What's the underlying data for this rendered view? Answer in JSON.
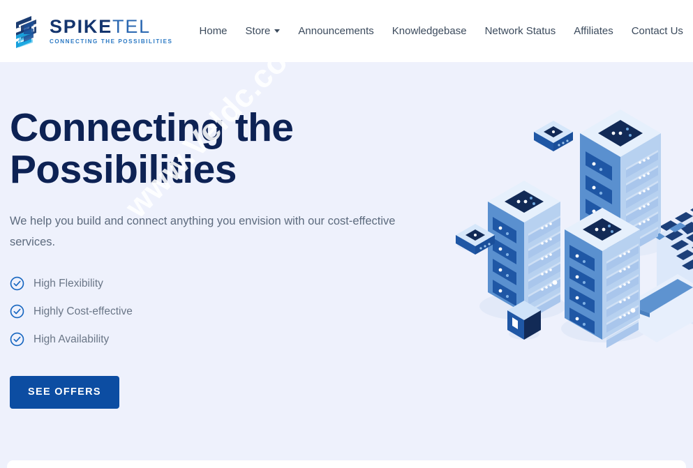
{
  "brand": {
    "name_bold": "SPIKE",
    "name_light": "TEL",
    "tagline": "CONNECTING THE POSSIBILITIES",
    "logo_icon": "spiketel-cube-s-logo"
  },
  "nav": {
    "items": [
      {
        "label": "Home",
        "has_caret": false
      },
      {
        "label": "Store",
        "has_caret": true
      },
      {
        "label": "Announcements",
        "has_caret": false
      },
      {
        "label": "Knowledgebase",
        "has_caret": false
      },
      {
        "label": "Network Status",
        "has_caret": false
      },
      {
        "label": "Affiliates",
        "has_caret": false
      },
      {
        "label": "Contact Us",
        "has_caret": false
      }
    ],
    "search_icon": "search-icon"
  },
  "hero": {
    "title": "Connecting the\nPossibilities",
    "subtitle": "We help you build and connect anything you envision with our cost-effective services.",
    "features": [
      {
        "label": "High Flexibility",
        "icon": "check-circle-icon"
      },
      {
        "label": "Highly Cost-effective",
        "icon": "check-circle-icon"
      },
      {
        "label": "High Availability",
        "icon": "check-circle-icon"
      }
    ],
    "cta_label": "SEE OFFERS",
    "illustration": "isometric-server-racks-and-laptop"
  },
  "watermark": {
    "text": "www.Veldc.com"
  },
  "colors": {
    "hero_background": "#eef1fc",
    "header_background": "#ffffff",
    "heading_navy": "#0d2254",
    "brand_navy": "#14356e",
    "brand_blue": "#2b79c4",
    "cta_blue": "#0c4da2",
    "check_blue": "#1565c0",
    "body_text": "#5d6b7e",
    "nav_text": "#3b4a5c"
  }
}
